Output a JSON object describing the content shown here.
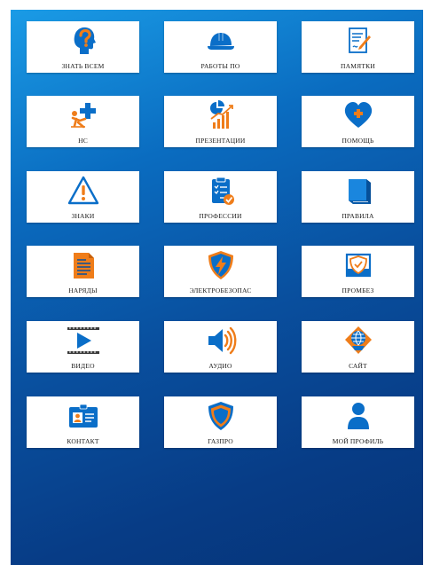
{
  "colors": {
    "orange": "#ef7d1a",
    "blue": "#0a6ec8",
    "background_top": "#1a9be6",
    "background_bottom": "#063478"
  },
  "tiles": [
    {
      "label": "ЗНАТЬ ВСЕМ",
      "icon": "head-question-icon"
    },
    {
      "label": "РАБОТЫ ПО",
      "icon": "hard-hat-icon"
    },
    {
      "label": "ПАМЯТКИ",
      "icon": "memo-pen-icon"
    },
    {
      "label": "НС",
      "icon": "first-aid-injury-icon"
    },
    {
      "label": "ПРЕЗЕНТАЦИИ",
      "icon": "presentation-chart-icon"
    },
    {
      "label": "ПОМОЩЬ",
      "icon": "heart-plus-icon"
    },
    {
      "label": "ЗНАКИ",
      "icon": "warning-sign-icon"
    },
    {
      "label": "ПРОФЕССИИ",
      "icon": "clipboard-checklist-icon"
    },
    {
      "label": "ПРАВИЛА",
      "icon": "book-icon"
    },
    {
      "label": "НАРЯДЫ",
      "icon": "document-icon"
    },
    {
      "label": "ЭЛЕКТРОБЕЗОПАС",
      "icon": "lightning-shield-icon"
    },
    {
      "label": "ПРОМБЕЗ",
      "icon": "industrial-shield-icon"
    },
    {
      "label": "ВИДЕО",
      "icon": "video-play-icon"
    },
    {
      "label": "АУДИО",
      "icon": "speaker-icon"
    },
    {
      "label": "САЙТ",
      "icon": "website-icon"
    },
    {
      "label": "КОНТАКТ",
      "icon": "id-card-icon"
    },
    {
      "label": "ГАЗПРО",
      "icon": "gas-shield-icon"
    },
    {
      "label": "МОЙ ПРОФИЛЬ",
      "icon": "user-profile-icon"
    }
  ]
}
